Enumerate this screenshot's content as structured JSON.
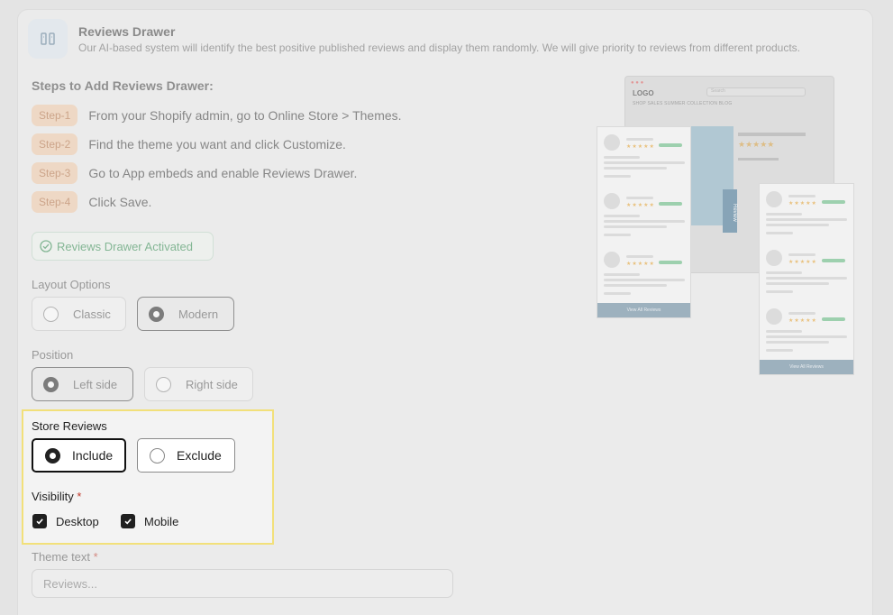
{
  "header": {
    "title": "Reviews Drawer",
    "description": "Our AI-based system will identify the best positive published reviews and display them randomly. We will give priority to reviews from different products.",
    "icon": "drawer-icon"
  },
  "steps": {
    "title": "Steps to Add Reviews Drawer:",
    "items": [
      {
        "badge": "Step-1",
        "text": "From your Shopify admin, go to Online Store > Themes."
      },
      {
        "badge": "Step-2",
        "text": "Find the theme you want and click Customize."
      },
      {
        "badge": "Step-3",
        "text": "Go to App embeds and enable Reviews Drawer."
      },
      {
        "badge": "Step-4",
        "text": "Click Save."
      }
    ]
  },
  "status": {
    "label": "Reviews Drawer Activated",
    "icon": "check-circle-icon",
    "color": "#2f8a4d"
  },
  "layout": {
    "label": "Layout Options",
    "options": [
      {
        "label": "Classic",
        "selected": false
      },
      {
        "label": "Modern",
        "selected": true
      }
    ]
  },
  "position": {
    "label": "Position",
    "options": [
      {
        "label": "Left side",
        "selected": true
      },
      {
        "label": "Right side",
        "selected": false
      }
    ]
  },
  "store_reviews": {
    "label": "Store Reviews",
    "options": [
      {
        "label": "Include",
        "selected": true
      },
      {
        "label": "Exclude",
        "selected": false
      }
    ]
  },
  "visibility": {
    "label": "Visibility",
    "required_mark": "*",
    "options": [
      {
        "label": "Desktop",
        "checked": true
      },
      {
        "label": "Mobile",
        "checked": true
      }
    ]
  },
  "theme_text": {
    "label": "Theme text",
    "required_mark": "*",
    "placeholder": "Reviews..."
  },
  "preview": {
    "logo": "LOGO",
    "search_placeholder": "Search",
    "nav": "SHOP   SALES   SUMMER COLLECTION   BLOG",
    "tab_label": "Review",
    "view_all": "View All Reviews",
    "stars": "★★★★★"
  },
  "colors": {
    "highlight_border": "#f2e07a",
    "step_badge_bg": "#f0c9a6",
    "accent_blue": "#4b7a98"
  }
}
